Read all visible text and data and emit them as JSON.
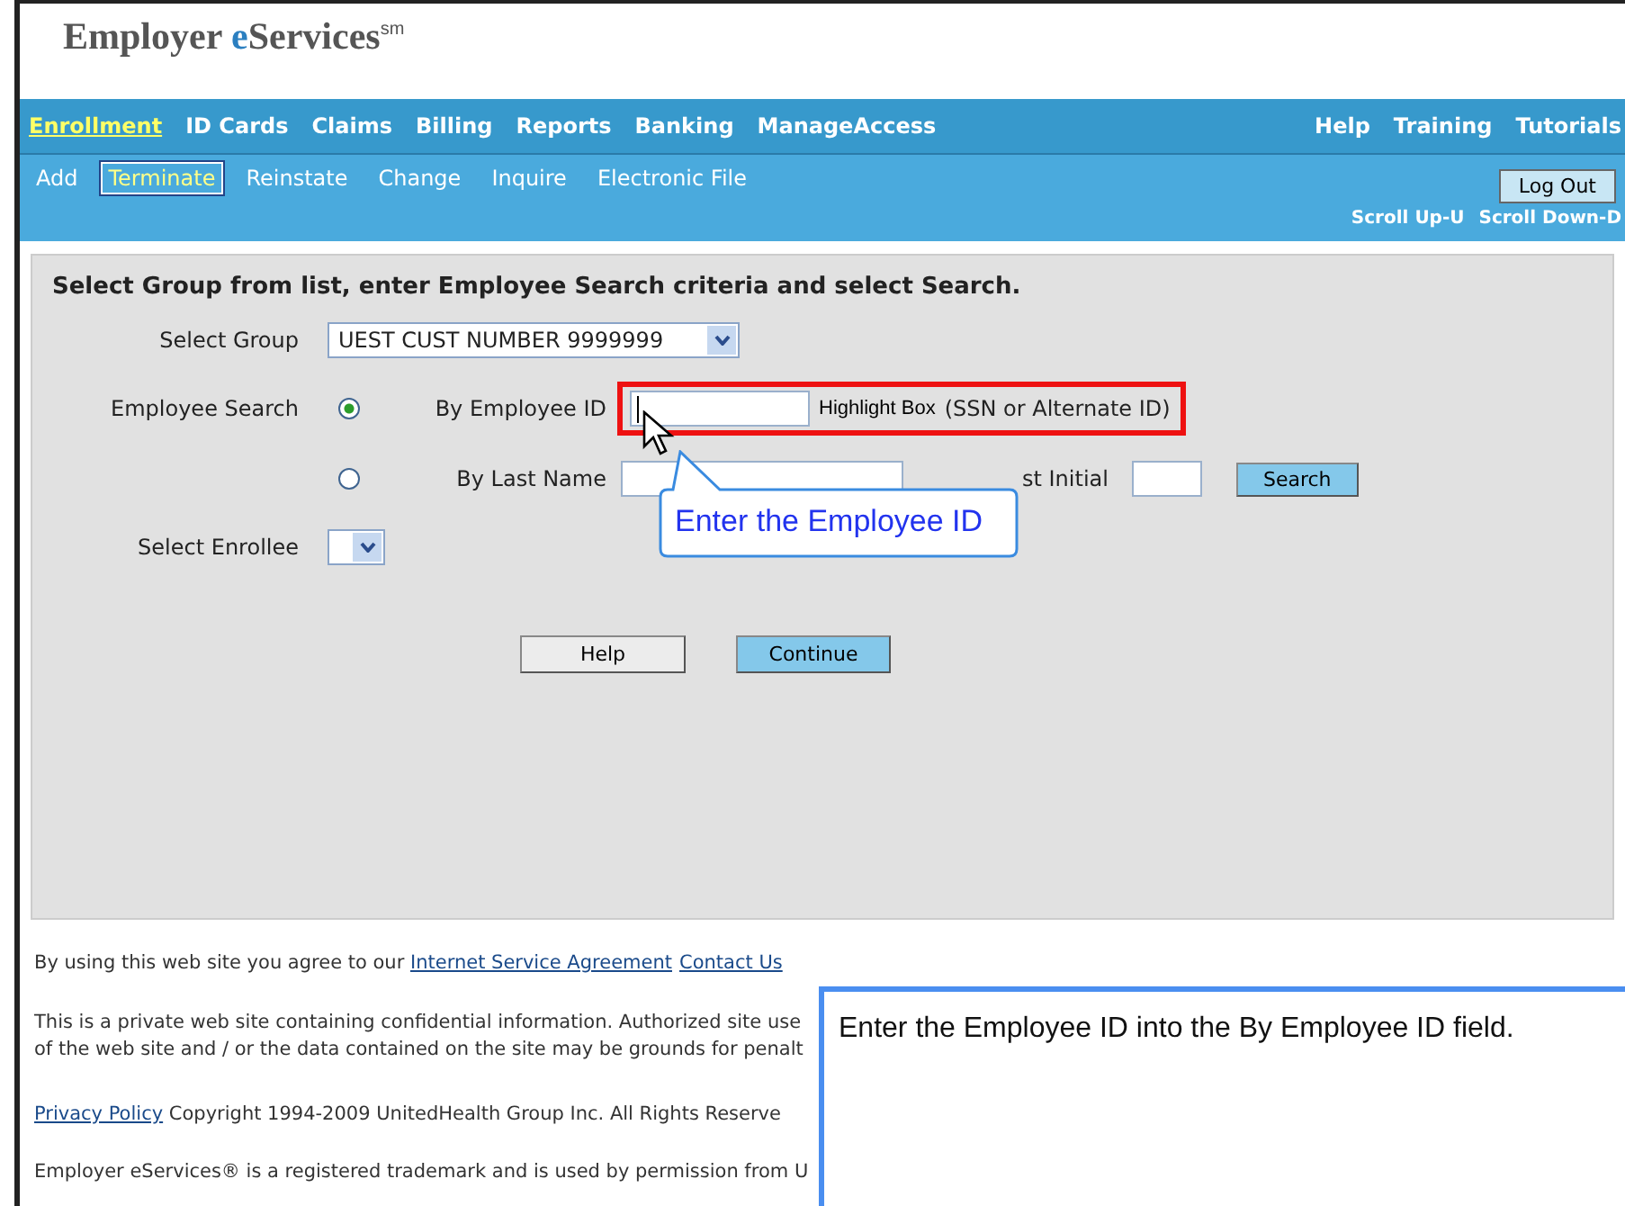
{
  "header": {
    "logo": "Employer",
    "logo_accent": "eServices",
    "logo_sup": "sm"
  },
  "nav": {
    "main": [
      {
        "label": "Enrollment",
        "selected": true
      },
      {
        "label": "ID Cards",
        "selected": false
      },
      {
        "label": "Claims",
        "selected": false
      },
      {
        "label": "Billing",
        "selected": false
      },
      {
        "label": "Reports",
        "selected": false
      },
      {
        "label": "Banking",
        "selected": false
      },
      {
        "label": "ManageAccess",
        "selected": false
      }
    ],
    "right": [
      "Help",
      "Training",
      "Tutorials"
    ],
    "sub": [
      {
        "label": "Add",
        "selected": false
      },
      {
        "label": "Terminate",
        "selected": true
      },
      {
        "label": "Reinstate",
        "selected": false
      },
      {
        "label": "Change",
        "selected": false
      },
      {
        "label": "Inquire",
        "selected": false
      },
      {
        "label": "Electronic File",
        "selected": false
      }
    ],
    "logout": "Log Out",
    "scroll_links": [
      "Scroll Up-U",
      "Scroll Down-D"
    ]
  },
  "form": {
    "instruction": "Select Group from list, enter Employee Search criteria and select Search.",
    "group_label": "Select Group",
    "group_value": "UEST CUST NUMBER 9999999",
    "search_label": "Employee Search",
    "options": [
      {
        "label": "By Employee ID",
        "selected": true
      },
      {
        "label": "By Last Name",
        "selected": false
      }
    ],
    "highlight_label": "Highlight Box",
    "id_hint": "(SSN or Alternate ID)",
    "initial_label": "st Initial",
    "search_button": "Search",
    "enrollee_label": "Select Enrollee",
    "buttons": [
      {
        "label": "Help",
        "kind": "plain"
      },
      {
        "label": "Continue",
        "kind": "primary"
      }
    ]
  },
  "callout": "Enter the Employee ID",
  "footer": {
    "agree": "By using this web site you agree to our",
    "links": [
      "Internet Service Agreement",
      "Contact Us"
    ],
    "private": [
      "This is a private web site containing confidential information. Authorized site use",
      "of the web site and / or the data contained on the site may be grounds for penalt"
    ],
    "privacy_link": "Privacy Policy",
    "copyright": "Copyright 1994-2009 UnitedHealth Group Inc. All Rights Reserve",
    "trademark": "Employer eServices® is a registered trademark and is used by permission from U"
  },
  "instruction_box": "Enter the Employee ID into the By Employee ID field."
}
